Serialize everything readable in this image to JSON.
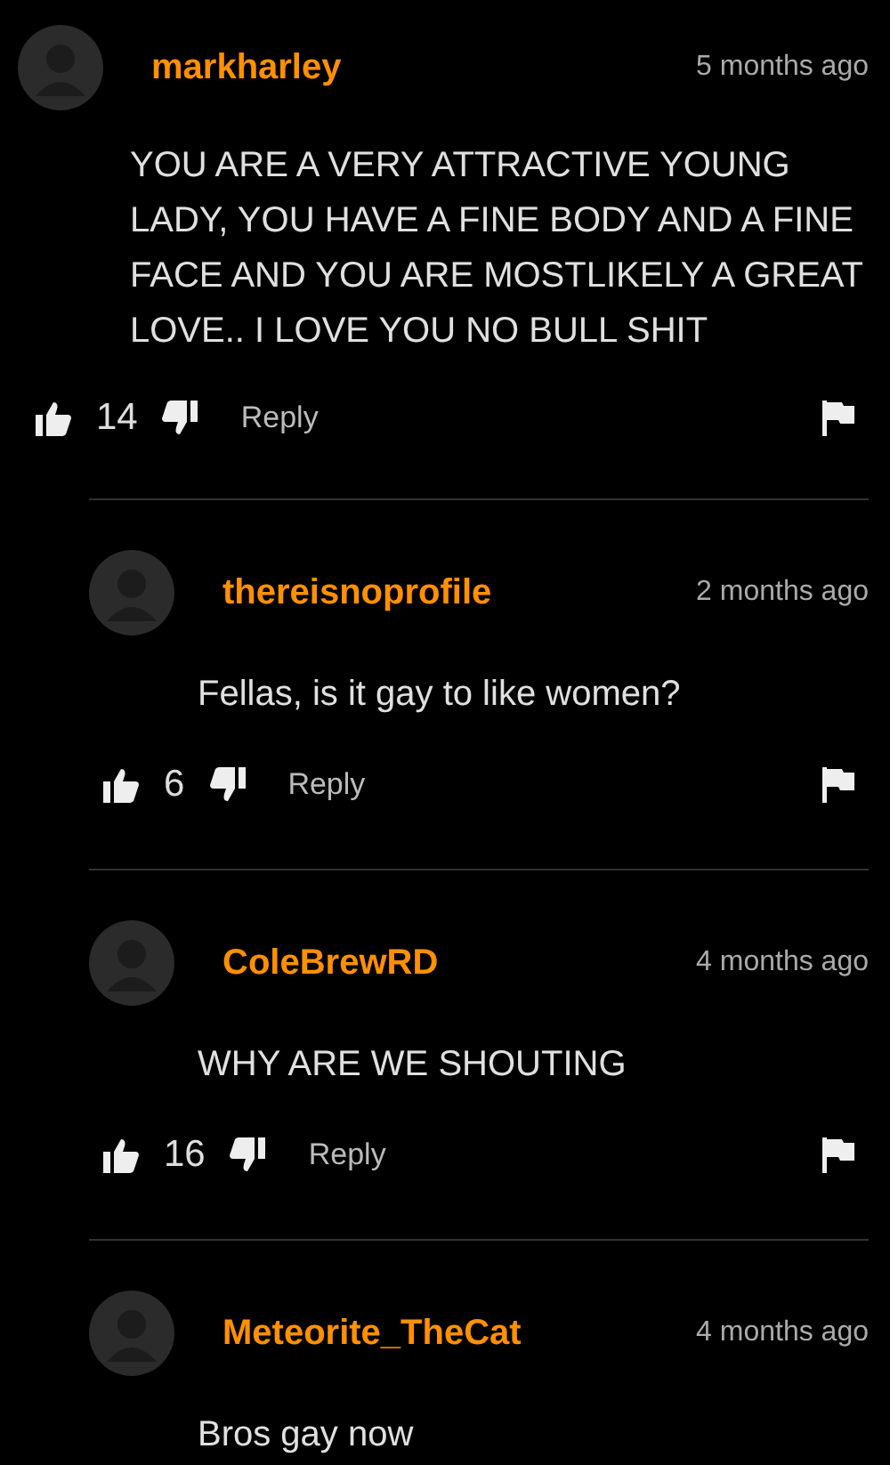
{
  "comments": [
    {
      "username": "markharley",
      "time": "5 months ago",
      "text": "YOU ARE A VERY ATTRACTIVE YOUNG LADY, YOU HAVE A FINE BODY AND A FINE FACE AND YOU ARE MOSTLIKELY A GREAT LOVE.. I LOVE YOU NO BULL SHIT",
      "likes": "14",
      "reply_label": "Reply",
      "replies": [
        {
          "username": "thereisnoprofile",
          "time": "2 months ago",
          "text": "Fellas, is it gay to like women?",
          "likes": "6",
          "reply_label": "Reply"
        },
        {
          "username": "ColeBrewRD",
          "time": "4 months ago",
          "text": "WHY ARE WE SHOUTING",
          "likes": "16",
          "reply_label": "Reply"
        },
        {
          "username": "Meteorite_TheCat",
          "time": "4 months ago",
          "text": "Bros gay now"
        }
      ]
    }
  ]
}
